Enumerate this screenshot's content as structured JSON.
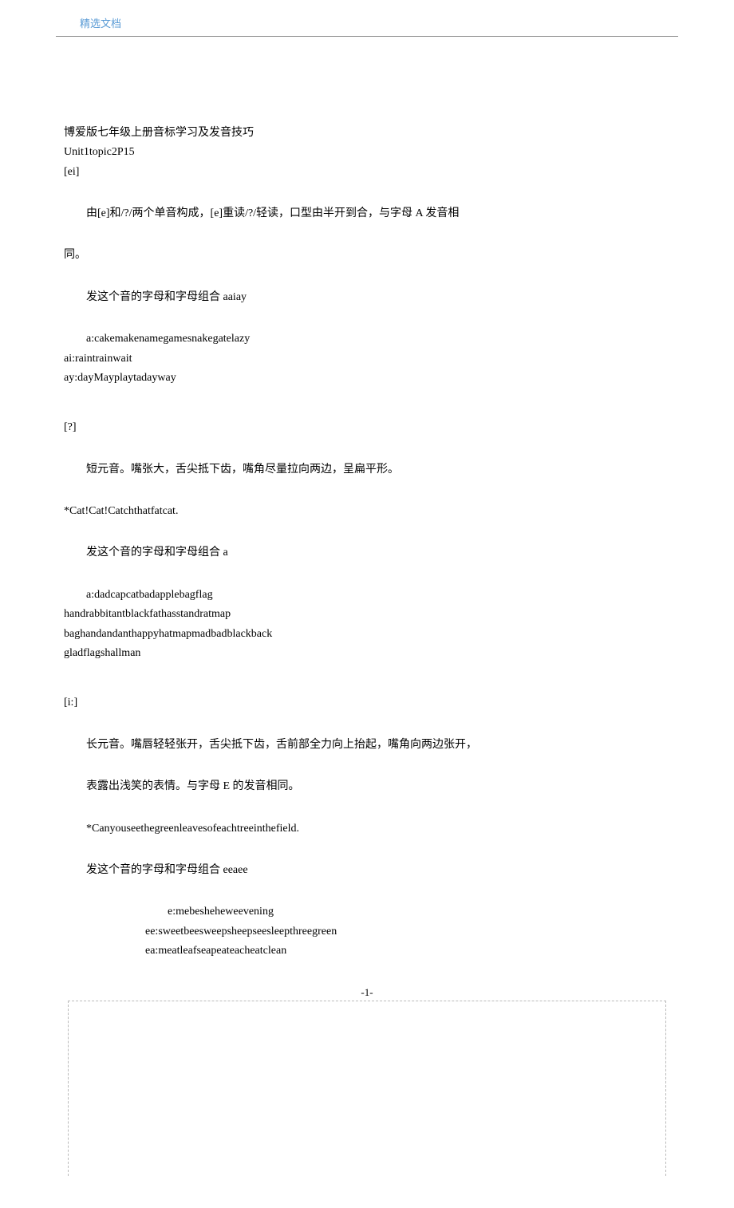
{
  "header": {
    "label": "精选文档"
  },
  "title": {
    "line1": "博爱版七年级上册音标学习及发音技巧",
    "line2": "Unit1topic2P15",
    "line3": "[ei]"
  },
  "sec_ei": {
    "desc1": "由[e]和/?/两个单音构成，[e]重读/?/轻读，口型由半开到合，与字母 A 发音相",
    "desc2": "同。",
    "rule": "发这个音的字母和字母组合 aaiay",
    "ex1": "a:cakemakenamegamesnakegatelazy",
    "ex2": "ai:raintrainwait",
    "ex3": "ay:dayMayplaytadayway"
  },
  "sec_ae": {
    "symbol": "[?]",
    "desc": "短元音。嘴张大，舌尖抵下齿，嘴角尽量拉向两边，呈扁平形。",
    "sentence": "*Cat!Cat!Catchthatfatcat.",
    "rule": "发这个音的字母和字母组合 a",
    "ex1": "a:dadcapcatbadapplebagflag",
    "ex2": "handrabbitantblackfathasstandratmap",
    "ex3": "baghandandanthappyhatmapmadbadblackback",
    "ex4": "gladflagshallman"
  },
  "sec_i": {
    "symbol": "[i:]",
    "desc1": "长元音。嘴唇轻轻张开，舌尖抵下齿，舌前部全力向上抬起，嘴角向两边张开，",
    "desc2": "表露出浅笑的表情。与字母 E 的发音相同。",
    "sentence": "*Canyouseethegreenleavesofeachtreeinthefield.",
    "rule": "发这个音的字母和字母组合 eeaee",
    "ex1": "e:mebesheheweevening",
    "ex2": "ee:sweetbeesweepsheepseesleepthreegreen",
    "ex3": "ea:meatleafseapeateacheatclean"
  },
  "footer": {
    "page": "-1-"
  }
}
